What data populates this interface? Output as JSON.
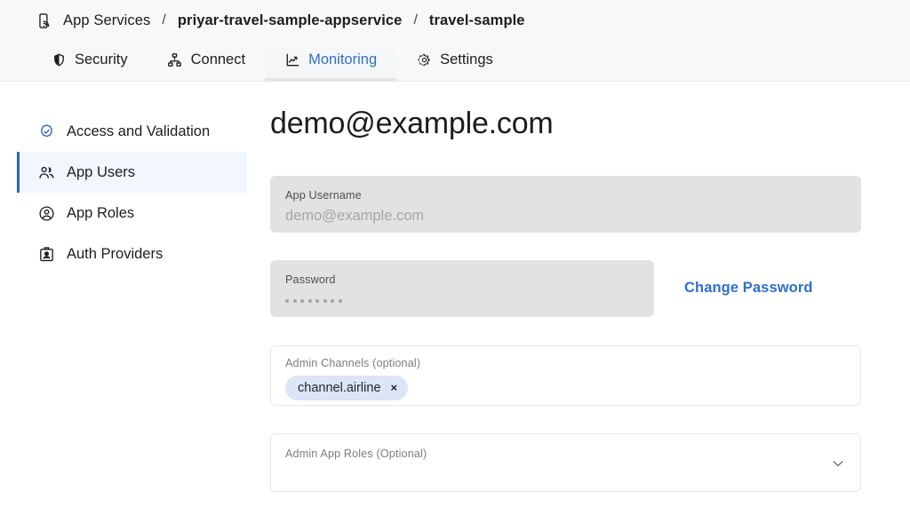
{
  "header": {
    "breadcrumb": {
      "icon": "mobile-app-icon",
      "root": "App Services",
      "separator": "/",
      "service": "priyar-travel-sample-appservice",
      "database": "travel-sample"
    },
    "tabs": [
      {
        "label": "Security",
        "icon": "shield-icon",
        "active": false
      },
      {
        "label": "Connect",
        "icon": "sitemap-icon",
        "active": false
      },
      {
        "label": "Monitoring",
        "icon": "chart-line-icon",
        "active": true
      },
      {
        "label": "Settings",
        "icon": "gear-icon",
        "active": false
      }
    ]
  },
  "sidebar": {
    "items": [
      {
        "label": "Access and Validation",
        "icon": "check-badge-icon",
        "active": false
      },
      {
        "label": "App Users",
        "icon": "users-icon",
        "active": true
      },
      {
        "label": "App Roles",
        "icon": "user-circle-icon",
        "active": false
      },
      {
        "label": "Auth Providers",
        "icon": "id-badge-icon",
        "active": false
      }
    ]
  },
  "main": {
    "page_title": "demo@example.com",
    "username_field": {
      "label": "App Username",
      "value": "demo@example.com"
    },
    "password_field": {
      "label": "Password",
      "masked_value": "••••••••",
      "dot_count": 8
    },
    "change_password_link": "Change Password",
    "admin_channels_field": {
      "label": "Admin Channels (optional)",
      "chips": [
        {
          "label": "channel.airline",
          "remove_icon": "×"
        }
      ]
    },
    "admin_app_roles_field": {
      "label": "Admin App Roles (Optional)",
      "value": "",
      "chevron_icon": "chevron-down-icon"
    }
  },
  "colors": {
    "accent_blue": "#2f6fd0",
    "active_bar_blue": "#2f63c8",
    "active_row_bg": "#f2f6fd",
    "chip_bg": "#dbe5f6",
    "field_filled_bg": "#e1e2e3",
    "header_bg": "#f7f8f9"
  }
}
